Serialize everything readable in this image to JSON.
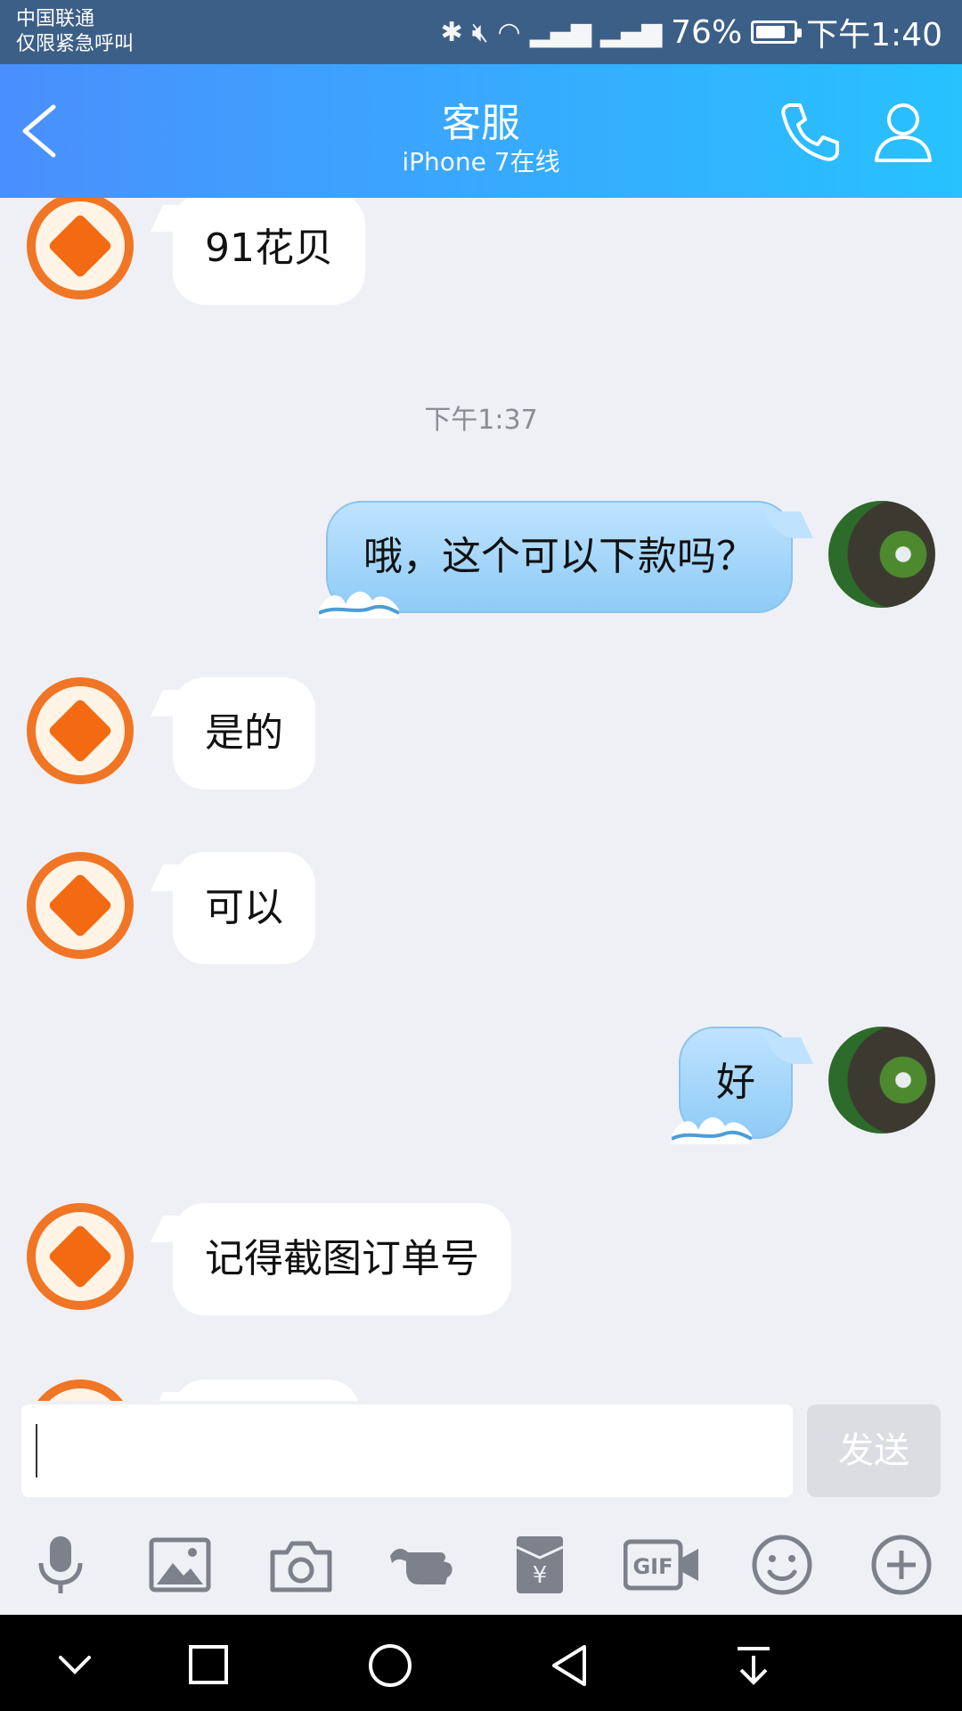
{
  "status_bar": {
    "carrier_line1": "中国联通",
    "carrier_line2": "仅限紧急呼叫",
    "battery": "76%",
    "battery_level": 0.76,
    "time": "下午1:40",
    "icons": [
      "bluetooth-icon",
      "mute-icon",
      "wifi-icon",
      "signal-2g-icon",
      "signal-x-icon",
      "battery-icon"
    ]
  },
  "header": {
    "title": "客服",
    "subtitle": "iPhone 7在线",
    "back_icon": "back-chevron-icon",
    "call_icon": "phone-icon",
    "profile_icon": "profile-icon"
  },
  "messages": [
    {
      "side": "left",
      "text": "91花贝"
    },
    {
      "type": "time",
      "text": "下午1:37"
    },
    {
      "side": "right",
      "text": "哦，这个可以下款吗？"
    },
    {
      "side": "left",
      "text": "是的"
    },
    {
      "side": "left",
      "text": "可以"
    },
    {
      "side": "right",
      "text": "好"
    },
    {
      "side": "left",
      "text": "记得截图订单号"
    }
  ],
  "input": {
    "value": "",
    "send_label": "发送"
  },
  "toolbar": {
    "items": [
      "voice-icon",
      "image-icon",
      "camera-icon",
      "poke-icon",
      "red-packet-icon",
      "gif-icon",
      "emoji-icon",
      "more-plus-icon"
    ]
  },
  "colors": {
    "header_start": "#4a8ffd",
    "header_end": "#27c2ff",
    "chat_bg": "#eff0f5",
    "agent_orange": "#f07524",
    "my_bubble": "#a8d6fb"
  }
}
